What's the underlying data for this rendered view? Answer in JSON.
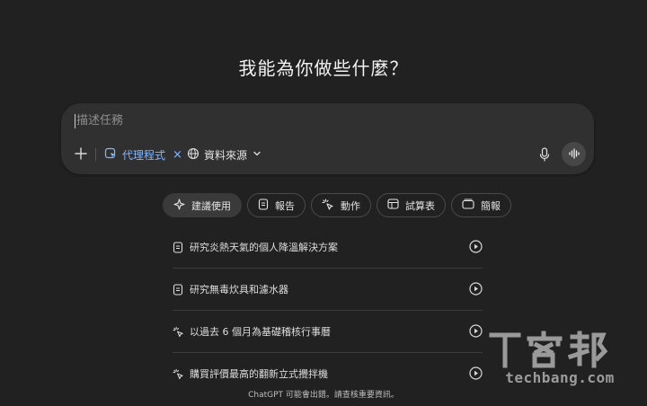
{
  "heading": "我能為你做些什麼？",
  "composer": {
    "placeholder": "描述任務",
    "agent_chip": "代理程式",
    "agent_close": "×",
    "source_chip": "資料來源",
    "plus_icon": "plus-icon",
    "mic_icon": "mic-icon",
    "voice_icon": "voice-mode-icon"
  },
  "pills": [
    {
      "label": "建議使用",
      "icon": "sparkle-icon",
      "active": true
    },
    {
      "label": "報告",
      "icon": "document-icon",
      "active": false
    },
    {
      "label": "動作",
      "icon": "action-icon",
      "active": false
    },
    {
      "label": "試算表",
      "icon": "spreadsheet-icon",
      "active": false
    },
    {
      "label": "簡報",
      "icon": "slides-icon",
      "active": false
    }
  ],
  "suggestions": [
    {
      "text": "研究炎熱天氣的個人降溫解決方案",
      "icon": "document-icon"
    },
    {
      "text": "研究無毒炊具和濾水器",
      "icon": "document-icon"
    },
    {
      "text": "以過去 6 個月為基礎稽核行事曆",
      "icon": "action-icon"
    },
    {
      "text": "購買評價最高的翻新立式攪拌機",
      "icon": "action-icon"
    }
  ],
  "footer": "ChatGPT 可能會出錯。請查核重要資訊。",
  "watermark": {
    "logo": "T客邦",
    "site": "techbang.com"
  },
  "colors": {
    "background": "#212121",
    "composer": "#303030",
    "accent": "#86b7ff"
  }
}
